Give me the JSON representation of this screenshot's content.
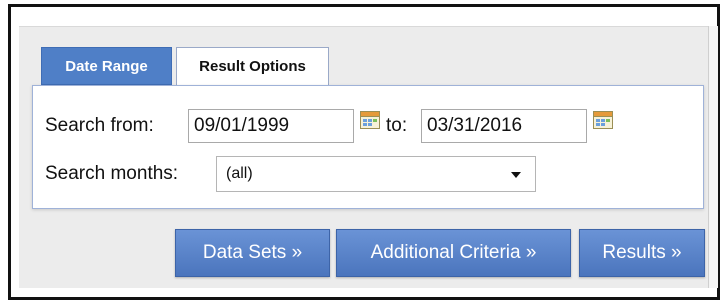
{
  "tabs": {
    "date_range": "Date Range",
    "result_options": "Result Options"
  },
  "date_range": {
    "search_from_label": "Search from:",
    "from_value": "09/01/1999",
    "to_label": "to:",
    "to_value": "03/31/2016",
    "search_months_label": "Search months:",
    "months_selected": "(all)"
  },
  "buttons": {
    "data_sets": "Data Sets »",
    "additional_criteria": "Additional Criteria »",
    "results": "Results »"
  },
  "colors": {
    "active_tab": "#4f7fc7",
    "button": "#5a83c9"
  }
}
